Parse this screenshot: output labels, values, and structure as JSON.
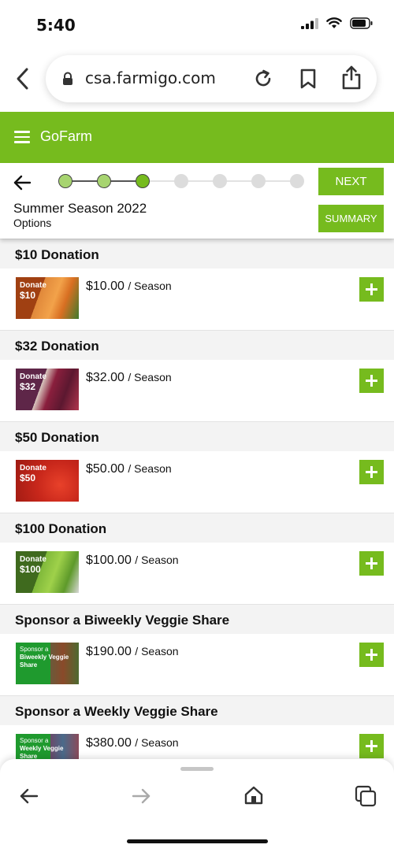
{
  "status": {
    "time": "5:40"
  },
  "browser": {
    "url": "csa.farmigo.com"
  },
  "app": {
    "brand": "GoFarm",
    "accent": "#76bb1e"
  },
  "wizard": {
    "season": "Summer Season 2022",
    "step_name": "Options",
    "next_label": "NEXT",
    "summary_label": "SUMMARY",
    "steps_total": 7,
    "steps_completed": 2,
    "current_step": 3
  },
  "products": [
    {
      "title": "$10 Donation",
      "price": "$10.00",
      "per": "/ Season",
      "thumb_line1": "Donate",
      "thumb_line2": "$10"
    },
    {
      "title": "$32 Donation",
      "price": "$32.00",
      "per": "/ Season",
      "thumb_line1": "Donate",
      "thumb_line2": "$32"
    },
    {
      "title": "$50 Donation",
      "price": "$50.00",
      "per": "/ Season",
      "thumb_line1": "Donate",
      "thumb_line2": "$50"
    },
    {
      "title": "$100 Donation",
      "price": "$100.00",
      "per": "/ Season",
      "thumb_line1": "Donate",
      "thumb_line2": "$100"
    },
    {
      "title": "Sponsor a Biweekly Veggie Share",
      "price": "$190.00",
      "per": "/ Season",
      "thumb_line1": "Sponsor a",
      "thumb_line2": "Biweekly Veggie Share"
    },
    {
      "title": "Sponsor a Weekly Veggie Share",
      "price": "$380.00",
      "per": "/ Season",
      "thumb_line1": "Sponsor a",
      "thumb_line2": "Weekly Veggie Share"
    }
  ]
}
